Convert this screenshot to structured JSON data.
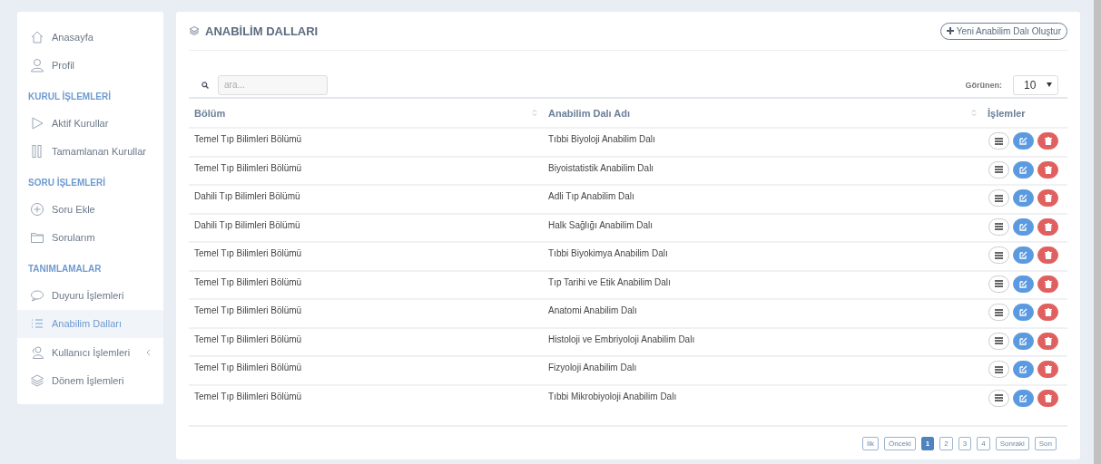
{
  "sidebar": {
    "items": [
      {
        "kind": "link",
        "label": "Anasayfa",
        "selected": false
      },
      {
        "kind": "link",
        "label": "Profil",
        "selected": false
      },
      {
        "kind": "header",
        "label": "KURUL İŞLEMLERİ"
      },
      {
        "kind": "link",
        "label": "Aktif Kurullar",
        "selected": false
      },
      {
        "kind": "link",
        "label": "Tamamlanan Kurullar",
        "selected": false
      },
      {
        "kind": "header",
        "label": "SORU İŞLEMLERİ"
      },
      {
        "kind": "link",
        "label": "Soru Ekle",
        "selected": false
      },
      {
        "kind": "link",
        "label": "Sorularım",
        "selected": false
      },
      {
        "kind": "header",
        "label": "TANIMLAMALAR"
      },
      {
        "kind": "link",
        "label": "Duyuru İşlemleri",
        "selected": false
      },
      {
        "kind": "link",
        "label": "Anabilim Dalları",
        "selected": true
      },
      {
        "kind": "submenu",
        "label": "Kullanıcı İşlemleri",
        "selected": false
      },
      {
        "kind": "link",
        "label": "Dönem İşlemleri",
        "selected": false
      }
    ]
  },
  "page": {
    "title": "ANABİLİM DALLARI",
    "new_button": "Yeni Anabilim Dalı Oluştur"
  },
  "search": {
    "placeholder": "ara..."
  },
  "page_size": {
    "label": "Görünen:",
    "value": "10"
  },
  "table": {
    "columns": [
      "Bölüm",
      "Anabilim Dalı Adı",
      "İşlemler"
    ],
    "rows": [
      [
        "Temel Tıp Bilimleri Bölümü",
        "Tıbbi Biyoloji Anabilim Dalı"
      ],
      [
        "Temel Tıp Bilimleri Bölümü",
        "Biyoistatistik Anabilim Dalı"
      ],
      [
        "Dahili Tıp Bilimleri Bölümü",
        "Adli Tıp Anabilim Dalı"
      ],
      [
        "Dahili Tıp Bilimleri Bölümü",
        "Halk Sağlığı Anabilim Dalı"
      ],
      [
        "Temel Tıp Bilimleri Bölümü",
        "Tıbbi Biyokimya Anabilim Dalı"
      ],
      [
        "Temel Tıp Bilimleri Bölümü",
        "Tıp Tarihi ve Etik Anabilim Dalı"
      ],
      [
        "Temel Tıp Bilimleri Bölümü",
        "Anatomi Anabilim Dalı"
      ],
      [
        "Temel Tıp Bilimleri Bölümü",
        "Histoloji ve Embriyoloji Anabilim Dalı"
      ],
      [
        "Temel Tıp Bilimleri Bölümü",
        "Fizyoloji Anabilim Dalı"
      ],
      [
        "Temel Tıp Bilimleri Bölümü",
        "Tıbbi Mikrobiyoloji Anabilim Dalı"
      ]
    ]
  },
  "pagination": [
    {
      "label": "İlk",
      "selected": false
    },
    {
      "label": "Önceki",
      "selected": false
    },
    {
      "label": "1",
      "selected": true
    },
    {
      "label": "2",
      "selected": false
    },
    {
      "label": "3",
      "selected": false
    },
    {
      "label": "4",
      "selected": false
    },
    {
      "label": "Sonraki",
      "selected": false
    },
    {
      "label": "Son",
      "selected": false
    }
  ]
}
